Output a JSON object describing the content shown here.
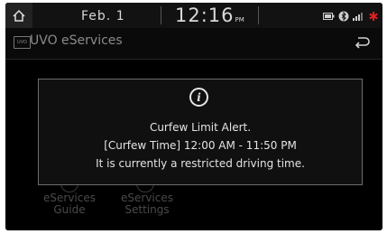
{
  "status_bar": {
    "date": "Feb. 1",
    "time": "12:16",
    "ampm": "PM",
    "icons": [
      "battery-icon",
      "bluetooth-icon",
      "signal-icon",
      "sos-icon"
    ],
    "alert_color": "#e02020"
  },
  "title_bar": {
    "title": "UVO eServices",
    "app_icon_text": "UVO"
  },
  "menu": {
    "items": [
      {
        "label_line1": "eServices",
        "label_line2": "Guide"
      },
      {
        "label_line1": "eServices",
        "label_line2": "Settings"
      }
    ]
  },
  "popup": {
    "icon": "info-icon",
    "line1": "Curfew Limit Alert.",
    "line2": "[Curfew Time] 12:00 AM - 11:50 PM",
    "line3": "It is currently a restricted driving time."
  }
}
